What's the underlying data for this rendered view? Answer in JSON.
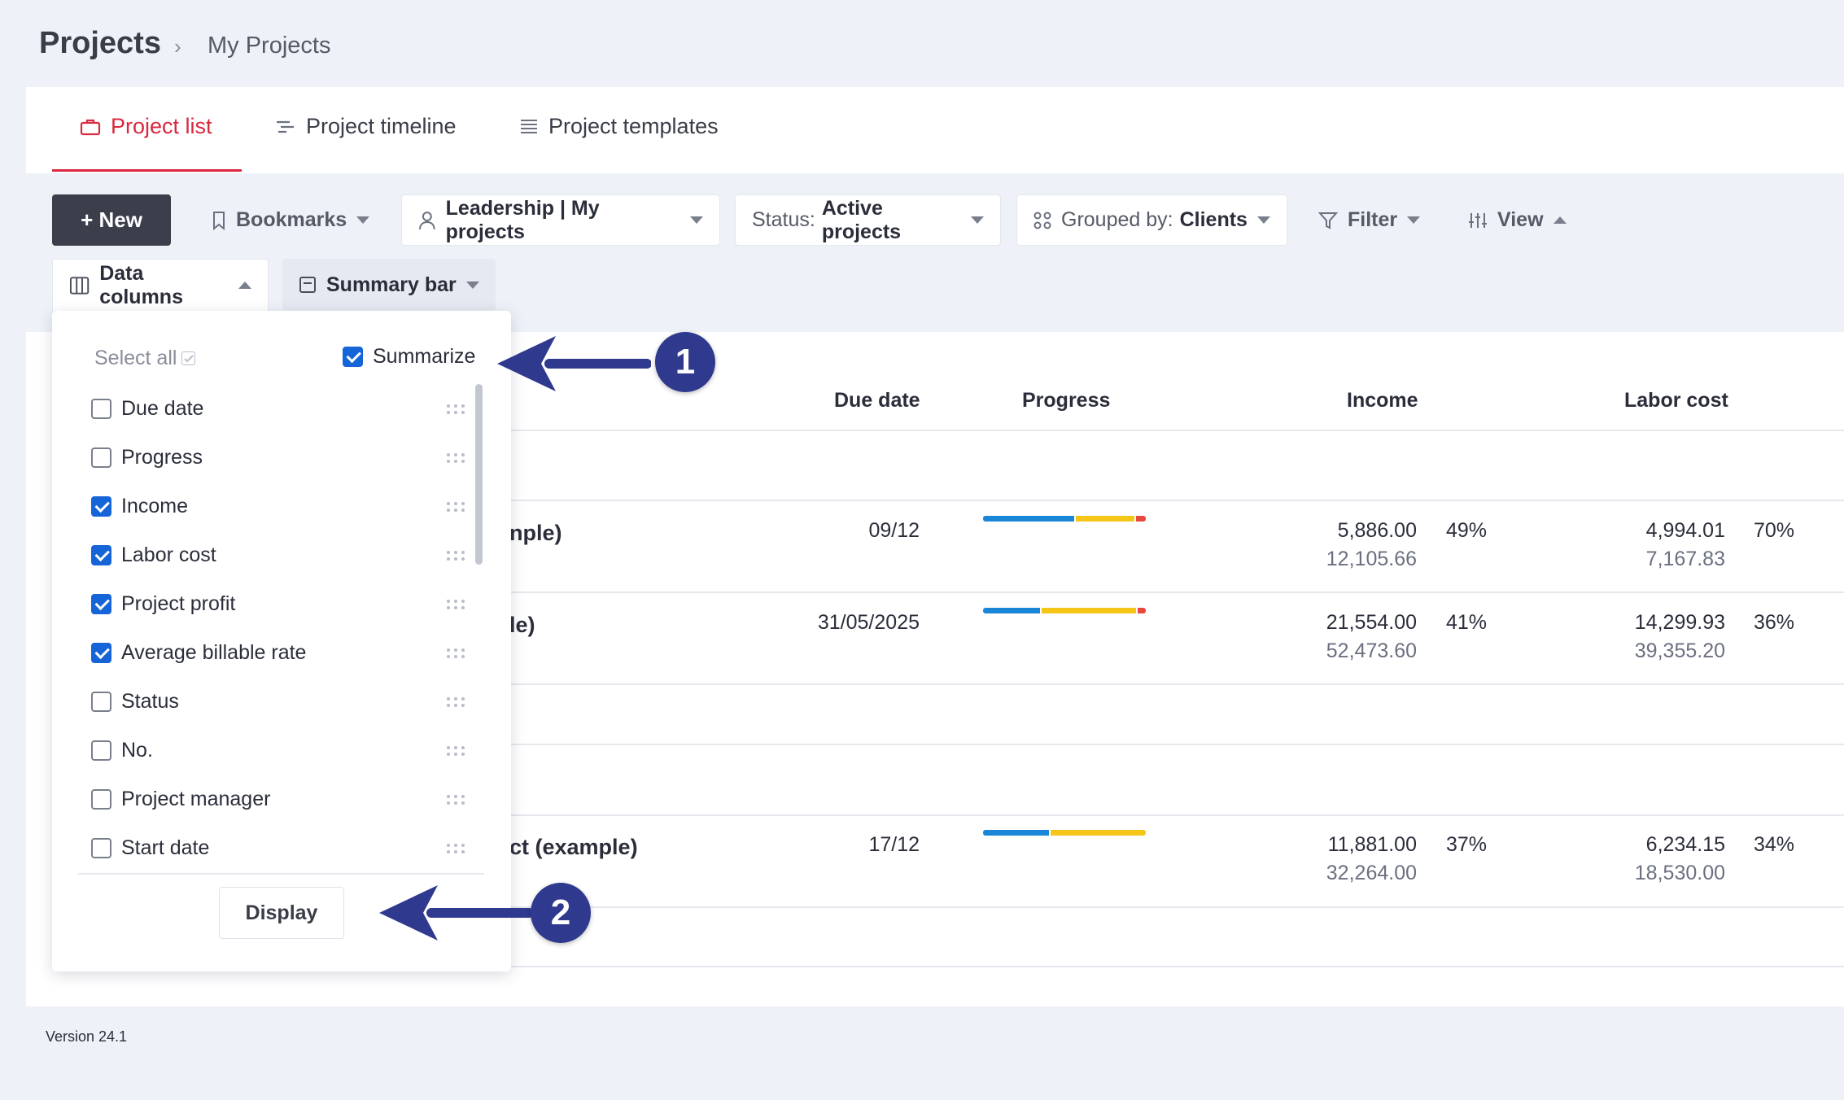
{
  "breadcrumb": {
    "title": "Projects",
    "separator": "›",
    "current": "My Projects"
  },
  "tabs": [
    {
      "label": "Project list",
      "icon": "briefcase-icon",
      "active": true
    },
    {
      "label": "Project timeline",
      "icon": "timeline-icon",
      "active": false
    },
    {
      "label": "Project templates",
      "icon": "list-icon",
      "active": false
    }
  ],
  "toolbar": {
    "new_label": "+ New",
    "bookmarks_label": "Bookmarks",
    "view_selector_label": "Leadership | My projects",
    "status_prefix": "Status:",
    "status_value": "Active projects",
    "grouped_prefix": "Grouped by:",
    "grouped_value": "Clients",
    "filter_label": "Filter",
    "view_label": "View",
    "data_columns_label": "Data columns",
    "summary_bar_label": "Summary bar"
  },
  "table": {
    "headers": {
      "due_date": "Due date",
      "progress": "Progress",
      "income": "Income",
      "labor_cost": "Labor cost"
    },
    "rows": [
      {
        "name": "nple)",
        "due": "09/12",
        "income": "5,886.00",
        "income_sub": "12,105.66",
        "income_pct": "49%",
        "labor": "4,994.01",
        "labor_sub": "7,167.83",
        "labor_pct": "70%",
        "progress": [
          0.56,
          0.36,
          0.06
        ]
      },
      {
        "name": "le)",
        "due": "31/05/2025",
        "income": "21,554.00",
        "income_sub": "52,473.60",
        "income_pct": "41%",
        "labor": "14,299.93",
        "labor_sub": "39,355.20",
        "labor_pct": "36%",
        "progress": [
          0.35,
          0.58,
          0.05
        ]
      },
      {
        "name": "ct (example)",
        "due": "17/12",
        "income": "11,881.00",
        "income_sub": "32,264.00",
        "income_pct": "37%",
        "labor": "6,234.15",
        "labor_sub": "18,530.00",
        "labor_pct": "34%",
        "progress": [
          0.41,
          0.59,
          0.0
        ]
      }
    ]
  },
  "panel": {
    "select_all_label": "Select all",
    "summarize_label": "Summarize",
    "summarize_checked": true,
    "options": [
      {
        "label": "Due date",
        "checked": false
      },
      {
        "label": "Progress",
        "checked": false
      },
      {
        "label": "Income",
        "checked": true
      },
      {
        "label": "Labor cost",
        "checked": true
      },
      {
        "label": "Project profit",
        "checked": true
      },
      {
        "label": "Average billable rate",
        "checked": true
      },
      {
        "label": "Status",
        "checked": false
      },
      {
        "label": "No.",
        "checked": false
      },
      {
        "label": "Project manager",
        "checked": false
      },
      {
        "label": "Start date",
        "checked": false
      }
    ],
    "display_label": "Display"
  },
  "annotations": [
    {
      "label": "1"
    },
    {
      "label": "2"
    }
  ],
  "colors": {
    "accent": "#d9283f",
    "checkbox": "#1565d8",
    "annotation": "#2f3a8f",
    "bar_blue": "#1a86d8",
    "bar_yellow": "#f5c518",
    "bar_red": "#e8473c"
  },
  "footer": {
    "version": "Version 24.1"
  }
}
